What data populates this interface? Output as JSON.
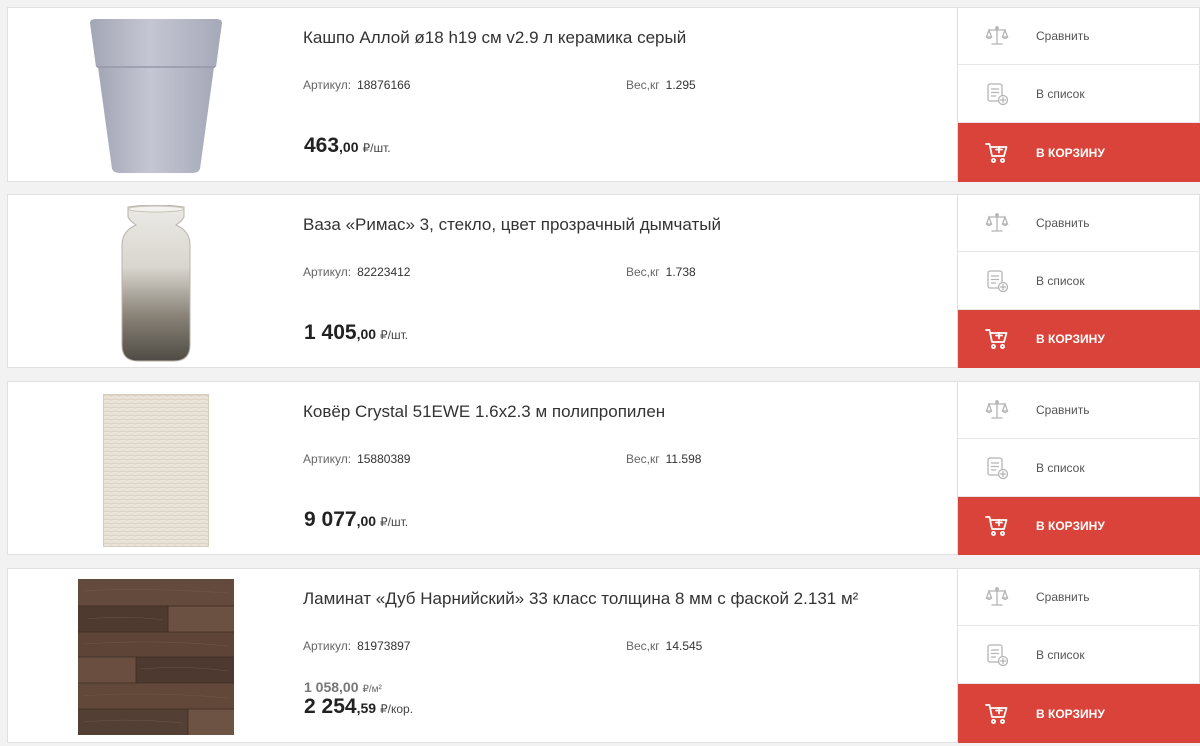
{
  "labels": {
    "compare": "Сравнить",
    "to_list": "В список",
    "to_cart": "В КОРЗИНУ",
    "article": "Артикул:",
    "weight": "Вес,кг"
  },
  "icons": {
    "compare": "scales-icon",
    "list": "list-add-icon",
    "cart": "cart-icon"
  },
  "colors": {
    "accent": "#d94339",
    "background": "#f2f2f2"
  },
  "products": [
    {
      "title": "Кашпо Аллой ø18 h19 см v2.9 л керамика серый",
      "article": "18876166",
      "weight": "1.295",
      "price_int": "463",
      "price_dec": ",00",
      "price_unit": "₽/шт.",
      "image": "gray-ceramic-planter"
    },
    {
      "title": "Ваза «Римас» 3, стекло, цвет прозрачный дымчатый",
      "article": "82223412",
      "weight": "1.738",
      "price_int": "1 405",
      "price_dec": ",00",
      "price_unit": "₽/шт.",
      "image": "smoky-glass-vase"
    },
    {
      "title": "Ковёр Crystal 51EWE 1.6x2.3 м полипропилен",
      "article": "15880389",
      "weight": "11.598",
      "price_int": "9 077",
      "price_dec": ",00",
      "price_unit": "₽/шт.",
      "image": "beige-rug"
    },
    {
      "title": "Ламинат «Дуб Нарнийский» 33 класс толщина 8 мм с фаской 2.131 м²",
      "article": "81973897",
      "weight": "14.545",
      "old_price": "1 058,00",
      "old_price_unit": "₽/м²",
      "price_int": "2 254",
      "price_dec": ",59",
      "price_unit": "₽/кор.",
      "image": "dark-oak-laminate"
    }
  ]
}
